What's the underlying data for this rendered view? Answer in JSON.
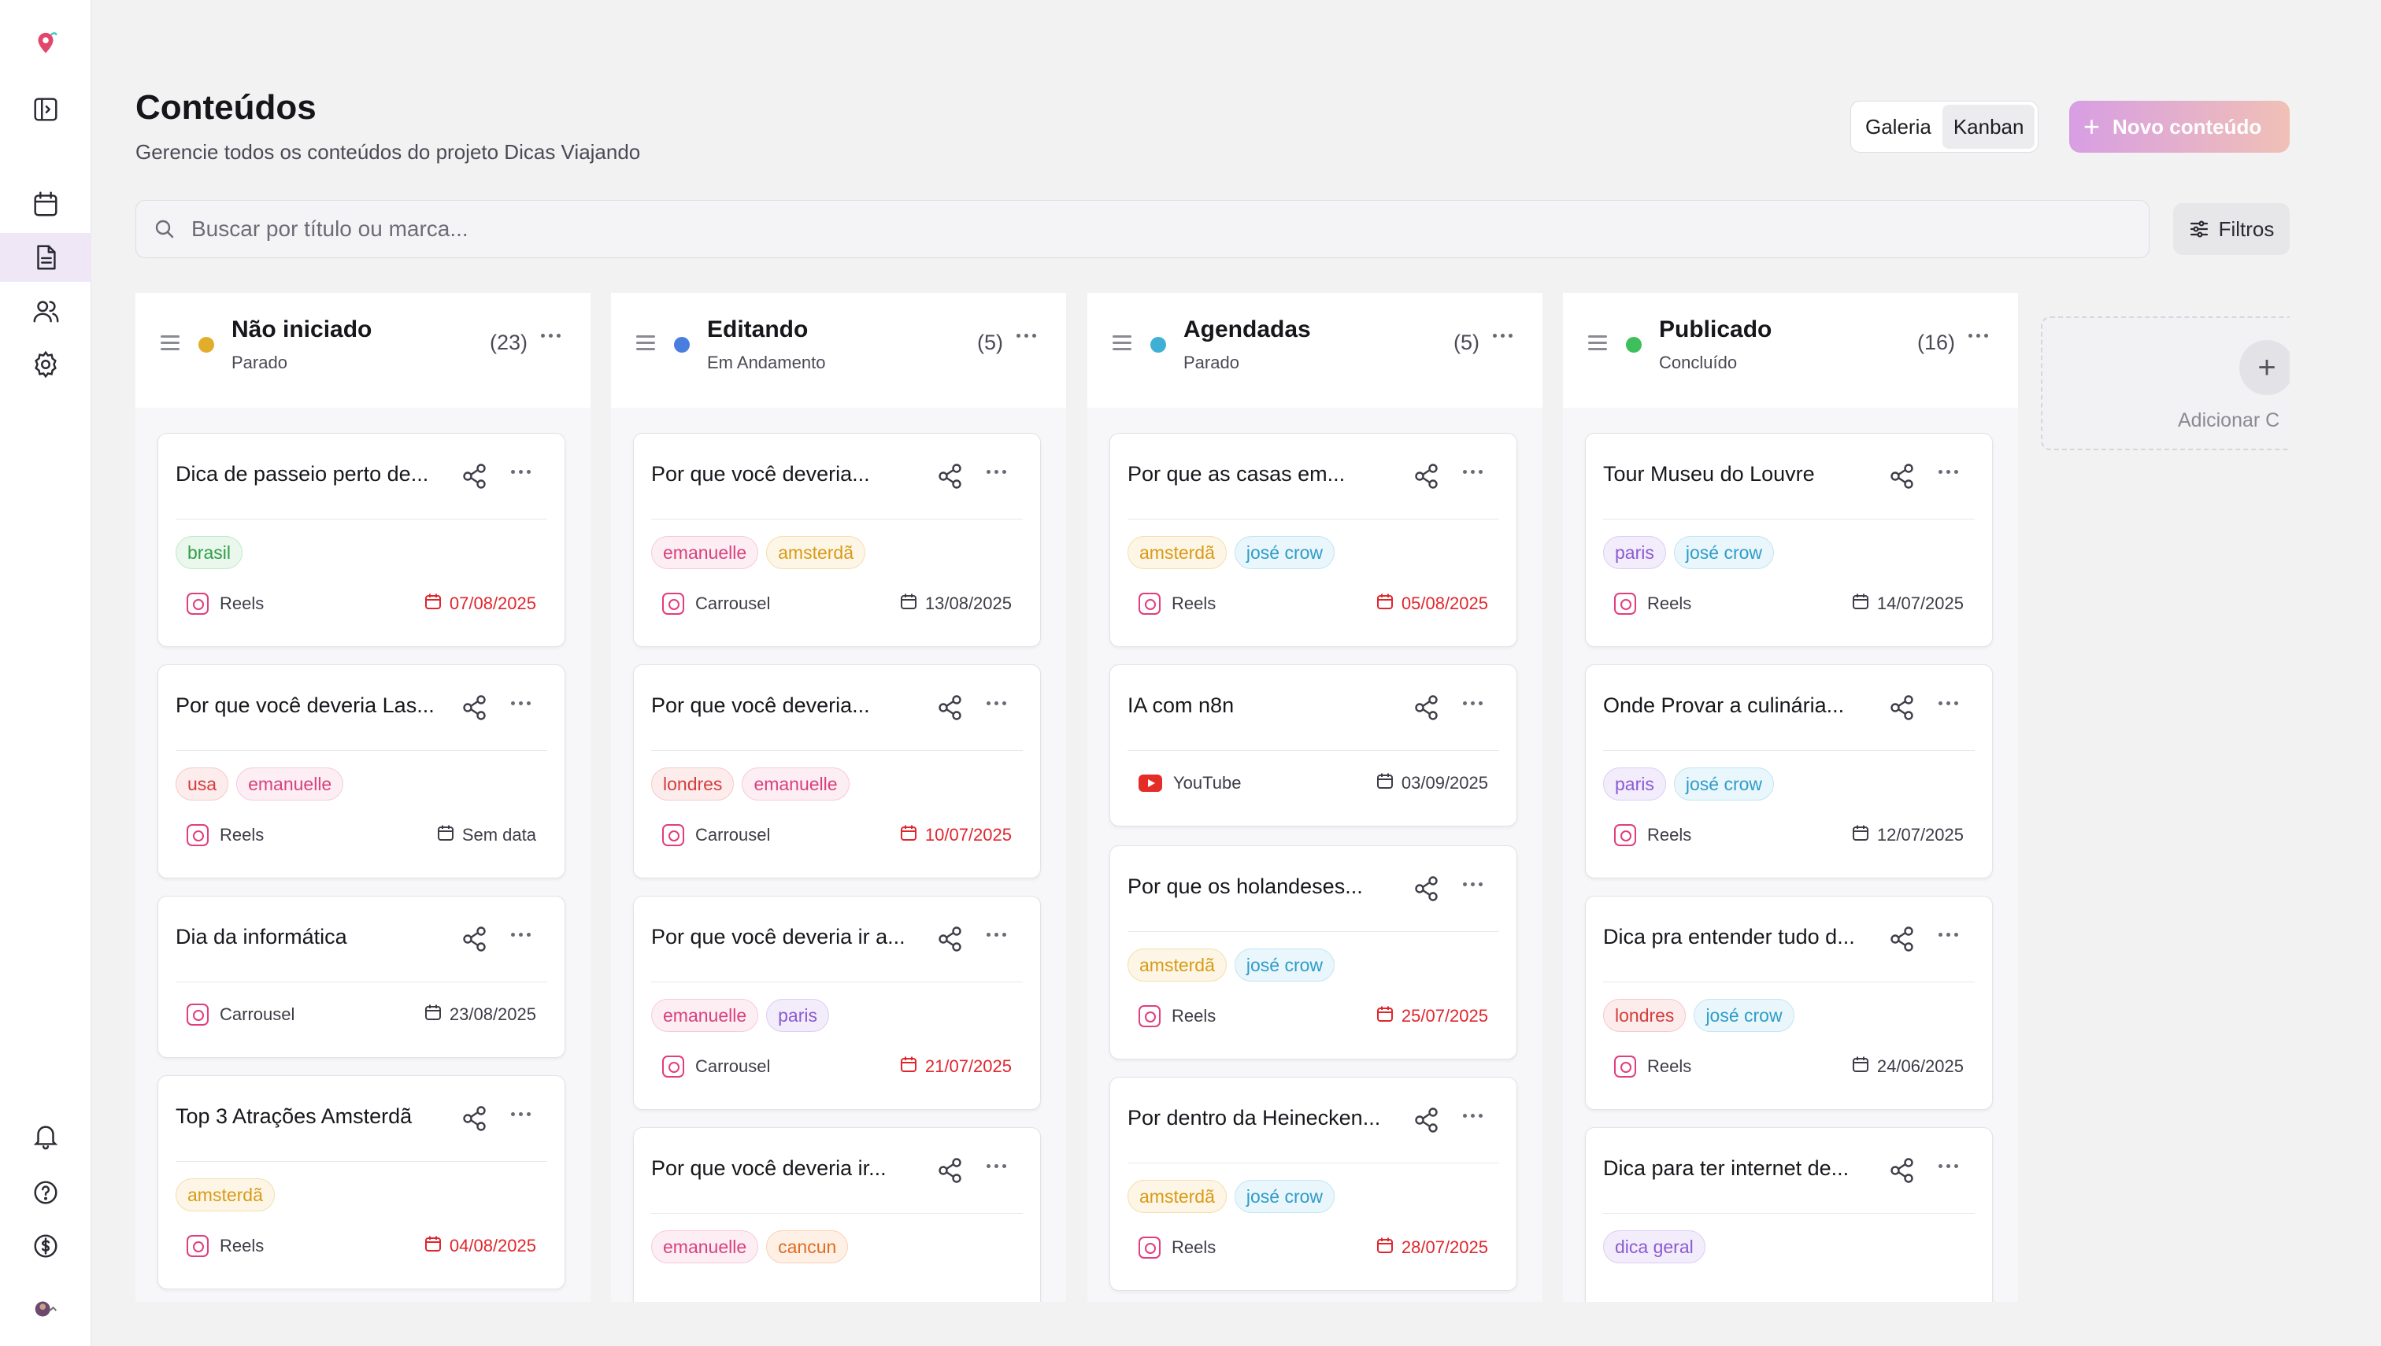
{
  "page": {
    "title": "Conteúdos",
    "subtitle": "Gerencie todos os conteúdos do projeto Dicas Viajando"
  },
  "view_toggle": {
    "gallery": "Galeria",
    "kanban": "Kanban",
    "active": "kanban"
  },
  "new_button": "Novo conteúdo",
  "search": {
    "placeholder": "Buscar por título ou marca..."
  },
  "filters_button": "Filtros",
  "add_column_label": "Adicionar C",
  "colors": {
    "accent_gradient": [
      "#d79ee3",
      "#f0c0b6"
    ],
    "overdue": "#e0262d",
    "sidebar_active": "#efe7f6"
  },
  "sidebar": {
    "items": [
      {
        "icon": "logo-icon"
      },
      {
        "icon": "sidebar-toggle-icon"
      },
      {
        "icon": "calendar-icon"
      },
      {
        "icon": "document-icon",
        "active": true
      },
      {
        "icon": "users-icon"
      },
      {
        "icon": "settings-icon"
      },
      {
        "icon": "bell-icon"
      },
      {
        "icon": "help-icon"
      },
      {
        "icon": "dollar-icon"
      },
      {
        "icon": "avatar"
      }
    ]
  },
  "columns": [
    {
      "title": "Não iniciado",
      "subtitle": "Parado",
      "count": "(23)",
      "dot_color": "#e3ad2c",
      "cards": [
        {
          "title": "Dica de passeio perto de...",
          "tags": [
            "brasil"
          ],
          "platform": "Reels",
          "platform_icon": "instagram-icon",
          "date": "07/08/2025",
          "overdue": true
        },
        {
          "title": "Por que você deveria Las...",
          "tags": [
            "usa",
            "emanuelle"
          ],
          "platform": "Reels",
          "platform_icon": "instagram-icon",
          "date": "Sem data",
          "overdue": false
        },
        {
          "title": "Dia da informática",
          "tags": [],
          "platform": "Carrousel",
          "platform_icon": "instagram-icon",
          "date": "23/08/2025",
          "overdue": false
        },
        {
          "title": "Top 3 Atrações Amsterdã",
          "tags": [
            "amsterdã"
          ],
          "platform": "Reels",
          "platform_icon": "instagram-icon",
          "date": "04/08/2025",
          "overdue": true
        }
      ]
    },
    {
      "title": "Editando",
      "subtitle": "Em Andamento",
      "count": "(5)",
      "dot_color": "#4a7de0",
      "cards": [
        {
          "title": "Por que você deveria...",
          "tags": [
            "emanuelle",
            "amsterdã"
          ],
          "platform": "Carrousel",
          "platform_icon": "instagram-icon",
          "date": "13/08/2025",
          "overdue": false
        },
        {
          "title": "Por que você deveria...",
          "tags": [
            "londres",
            "emanuelle"
          ],
          "platform": "Carrousel",
          "platform_icon": "instagram-icon",
          "date": "10/07/2025",
          "overdue": true
        },
        {
          "title": "Por que você deveria ir a...",
          "tags": [
            "emanuelle",
            "paris"
          ],
          "platform": "Carrousel",
          "platform_icon": "instagram-icon",
          "date": "21/07/2025",
          "overdue": true
        },
        {
          "title": "Por que você deveria ir...",
          "tags": [
            "emanuelle",
            "cancun"
          ],
          "platform": "",
          "platform_icon": "",
          "date": "",
          "overdue": false
        }
      ]
    },
    {
      "title": "Agendadas",
      "subtitle": "Parado",
      "count": "(5)",
      "dot_color": "#3fb0d5",
      "cards": [
        {
          "title": "Por que as casas em...",
          "tags": [
            "amsterdã",
            "josé crow"
          ],
          "platform": "Reels",
          "platform_icon": "instagram-icon",
          "date": "05/08/2025",
          "overdue": true
        },
        {
          "title": "IA com n8n",
          "tags": [],
          "platform": "YouTube",
          "platform_icon": "youtube-icon",
          "date": "03/09/2025",
          "overdue": false
        },
        {
          "title": "Por que os holandeses...",
          "tags": [
            "amsterdã",
            "josé crow"
          ],
          "platform": "Reels",
          "platform_icon": "instagram-icon",
          "date": "25/07/2025",
          "overdue": true
        },
        {
          "title": "Por dentro da Heinecken...",
          "tags": [
            "amsterdã",
            "josé crow"
          ],
          "platform": "Reels",
          "platform_icon": "instagram-icon",
          "date": "28/07/2025",
          "overdue": true
        }
      ]
    },
    {
      "title": "Publicado",
      "subtitle": "Concluído",
      "count": "(16)",
      "dot_color": "#3fbe5c",
      "cards": [
        {
          "title": "Tour Museu do Louvre",
          "tags": [
            "paris",
            "josé crow"
          ],
          "platform": "Reels",
          "platform_icon": "instagram-icon",
          "date": "14/07/2025",
          "overdue": false
        },
        {
          "title": "Onde Provar a culinária...",
          "tags": [
            "paris",
            "josé crow"
          ],
          "platform": "Reels",
          "platform_icon": "instagram-icon",
          "date": "12/07/2025",
          "overdue": false
        },
        {
          "title": "Dica pra entender tudo d...",
          "tags": [
            "londres",
            "josé crow"
          ],
          "platform": "Reels",
          "platform_icon": "instagram-icon",
          "date": "24/06/2025",
          "overdue": false
        },
        {
          "title": "Dica para ter internet de...",
          "tags": [
            "dica geral"
          ],
          "platform": "",
          "platform_icon": "",
          "date": "",
          "overdue": false
        }
      ]
    }
  ],
  "tag_styles": {
    "brasil": {
      "bg": "#eaf7ec",
      "border": "#c4e7cb",
      "color": "#2f9e48"
    },
    "usa": {
      "bg": "#fdecec",
      "border": "#f6c9c9",
      "color": "#d63c3c"
    },
    "emanuelle": {
      "bg": "#fdeef4",
      "border": "#f6cadb",
      "color": "#d9417d"
    },
    "amsterdã": {
      "bg": "#fdf6e6",
      "border": "#f3dfae",
      "color": "#d99a18"
    },
    "londres": {
      "bg": "#fdecec",
      "border": "#f6c9c9",
      "color": "#d63c3c"
    },
    "paris": {
      "bg": "#f2ecfb",
      "border": "#ddcef4",
      "color": "#8a5bd3"
    },
    "cancun": {
      "bg": "#fff0e6",
      "border": "#f7d2b8",
      "color": "#e06b1e"
    },
    "josé crow": {
      "bg": "#e9f6fb",
      "border": "#c3e5f2",
      "color": "#2f9cc8"
    },
    "dica geral": {
      "bg": "#f2ecfb",
      "border": "#ddcef4",
      "color": "#8a5bd3"
    }
  }
}
